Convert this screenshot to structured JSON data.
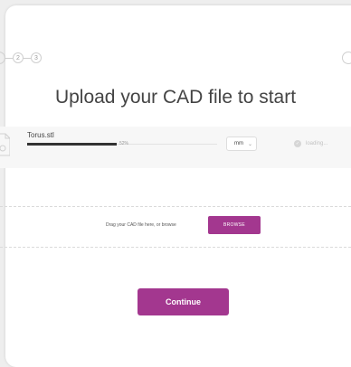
{
  "stepper": {
    "steps": [
      "2",
      "3"
    ]
  },
  "title": "Upload your CAD file to start",
  "file": {
    "name": "Torus.stl",
    "progress_percent": 52,
    "progress_label": "52%",
    "unit": "mm",
    "status": "loading..."
  },
  "drop_zone": {
    "text": "Drag your CAD file here, or browse",
    "browse_label": "BROWSE"
  },
  "continue_label": "Continue",
  "colors": {
    "accent": "#a3378f",
    "progress": "#333333"
  },
  "icons": [
    "file-icon",
    "chevron-down-icon",
    "check-circle-icon"
  ]
}
